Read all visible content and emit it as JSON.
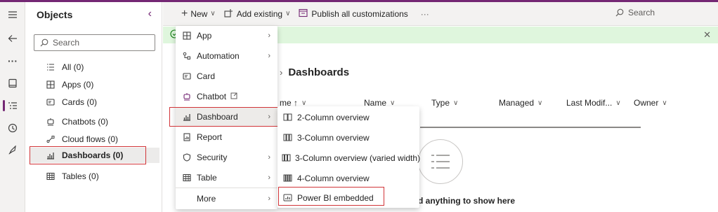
{
  "colors": {
    "accent": "#742774",
    "highlight": "#d13438",
    "success": "#dff6dd"
  },
  "rail": {
    "items": [
      {
        "icon": "hamburger-icon"
      },
      {
        "icon": "back-arrow-icon"
      },
      {
        "icon": "more-icon"
      },
      {
        "icon": "book-icon"
      },
      {
        "icon": "objects-list-icon",
        "active": true
      },
      {
        "icon": "history-icon"
      },
      {
        "icon": "rocket-icon"
      }
    ]
  },
  "objects": {
    "title": "Objects",
    "search_placeholder": "Search",
    "items": [
      {
        "icon": "list-icon",
        "label": "All (0)"
      },
      {
        "icon": "apps-icon",
        "label": "Apps (0)"
      },
      {
        "icon": "card-icon",
        "label": "Cards (0)"
      },
      {
        "icon": "chatbot-icon",
        "label": "Chatbots (0)"
      },
      {
        "icon": "cloud-flow-icon",
        "label": "Cloud flows (0)"
      },
      {
        "icon": "dashboard-icon",
        "label": "Dashboards (0)",
        "selected": true
      },
      {
        "icon": "table-icon",
        "label": "Tables (0)"
      }
    ]
  },
  "commandbar": {
    "new_label": "New",
    "add_existing_label": "Add existing",
    "publish_label": "Publish all customizations",
    "more_label": "···",
    "search_placeholder": "Search"
  },
  "main": {
    "breadcrumb": "Dashboards",
    "columns": [
      "me ↑",
      "Name",
      "Type",
      "Managed",
      "Last Modif...",
      "Owner"
    ],
    "empty_text": "d anything to show here"
  },
  "new_menu": {
    "items": [
      {
        "icon": "app-icon",
        "label": "App",
        "submenu": true
      },
      {
        "icon": "automation-icon",
        "label": "Automation",
        "submenu": true
      },
      {
        "icon": "card-icon",
        "label": "Card",
        "submenu": false
      },
      {
        "icon": "chatbot-icon",
        "label": "Chatbot",
        "submenu": false,
        "external": true
      },
      {
        "icon": "dashboard-icon",
        "label": "Dashboard",
        "submenu": true,
        "active": true
      },
      {
        "icon": "report-icon",
        "label": "Report",
        "submenu": false
      },
      {
        "icon": "security-icon",
        "label": "Security",
        "submenu": true
      },
      {
        "icon": "table-icon",
        "label": "Table",
        "submenu": true
      },
      {
        "icon": "",
        "label": "More",
        "submenu": true
      }
    ]
  },
  "dashboard_submenu": {
    "items": [
      {
        "icon": "two-column-icon",
        "label": "2-Column overview"
      },
      {
        "icon": "three-column-icon",
        "label": "3-Column overview"
      },
      {
        "icon": "three-column-varied-icon",
        "label": "3-Column overview (varied width)"
      },
      {
        "icon": "four-column-icon",
        "label": "4-Column overview"
      },
      {
        "icon": "power-bi-icon",
        "label": "Power BI embedded",
        "highlighted": true
      }
    ]
  }
}
